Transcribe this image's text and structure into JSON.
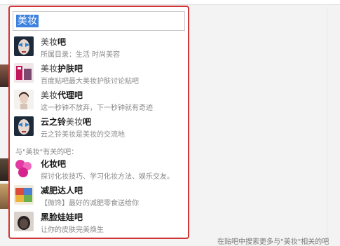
{
  "search": {
    "query": "美妆"
  },
  "suggestions": [
    {
      "title_hl": "美妆",
      "title_rest": "吧",
      "subtitle": "所属目录：生活  时尚美容",
      "icon": "face-makeup-thumb"
    },
    {
      "title_hl": "美妆",
      "title_rest": "护肤吧",
      "subtitle": "百度贴吧最大美妆护肤讨论贴吧",
      "icon": "skincare-thumb"
    },
    {
      "title_hl": "美妆",
      "title_rest": "代理吧",
      "subtitle": "这一秒钟不放弃，下一秒钟就有奇迹",
      "icon": "portrait-thumb"
    },
    {
      "title_pre": "云之铃",
      "title_hl": "美妆",
      "title_rest": "吧",
      "subtitle": "云之铃美妆是美妆的交流地",
      "icon": "face-makeup-thumb"
    }
  ],
  "related": {
    "label": "与\"美妆\"有关的吧：",
    "items": [
      {
        "title": "化妆吧",
        "subtitle": "探讨化妆技巧、学习化妆方法、娱乐交友。",
        "icon": "huazhuang-logo"
      },
      {
        "title": "减肥达人吧",
        "subtitle": "【微馋】最好的减肥零食送给你",
        "icon": "snack-thumb"
      },
      {
        "title": "黑脸娃娃吧",
        "subtitle": "让你的皮肤完美焕生",
        "icon": "doll-face-thumb"
      }
    ]
  },
  "footer": {
    "text": "在贴吧中搜索更多与\"美妆\"相关的吧"
  },
  "colors": {
    "highlight_border": "#d23535",
    "selection": "#3d82df"
  }
}
